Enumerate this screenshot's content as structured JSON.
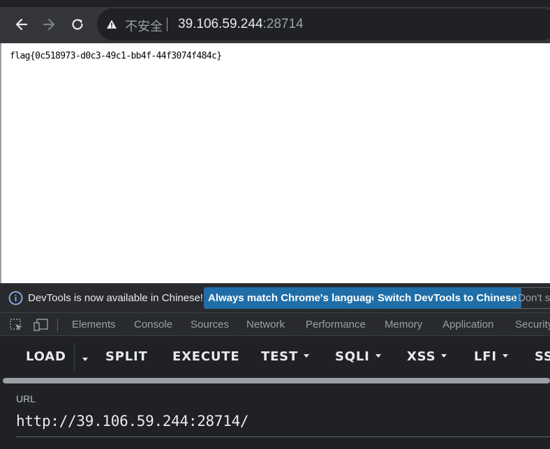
{
  "browser": {
    "insecure_label": "不安全",
    "url_host": "39.106.59.244",
    "url_port": ":28714"
  },
  "page": {
    "content_text": "flag{0c518973-d0c3-49c1-bb4f-44f3074f484c}"
  },
  "devtools_infobar": {
    "message": "DevTools is now available in Chinese!",
    "match_language_label": "Always match Chrome's language",
    "switch_label": "Switch DevTools to Chinese",
    "dont_show_label": "Don't s"
  },
  "devtools_tabs": [
    "Elements",
    "Console",
    "Sources",
    "Network",
    "Performance",
    "Memory",
    "Application",
    "Security"
  ],
  "hackbar": {
    "buttons": [
      "LOAD",
      "SPLIT",
      "EXECUTE",
      "TEST",
      "SQLI",
      "XSS",
      "LFI",
      "SS"
    ],
    "url_label": "URL",
    "url_value": "http://39.106.59.244:28714/"
  }
}
